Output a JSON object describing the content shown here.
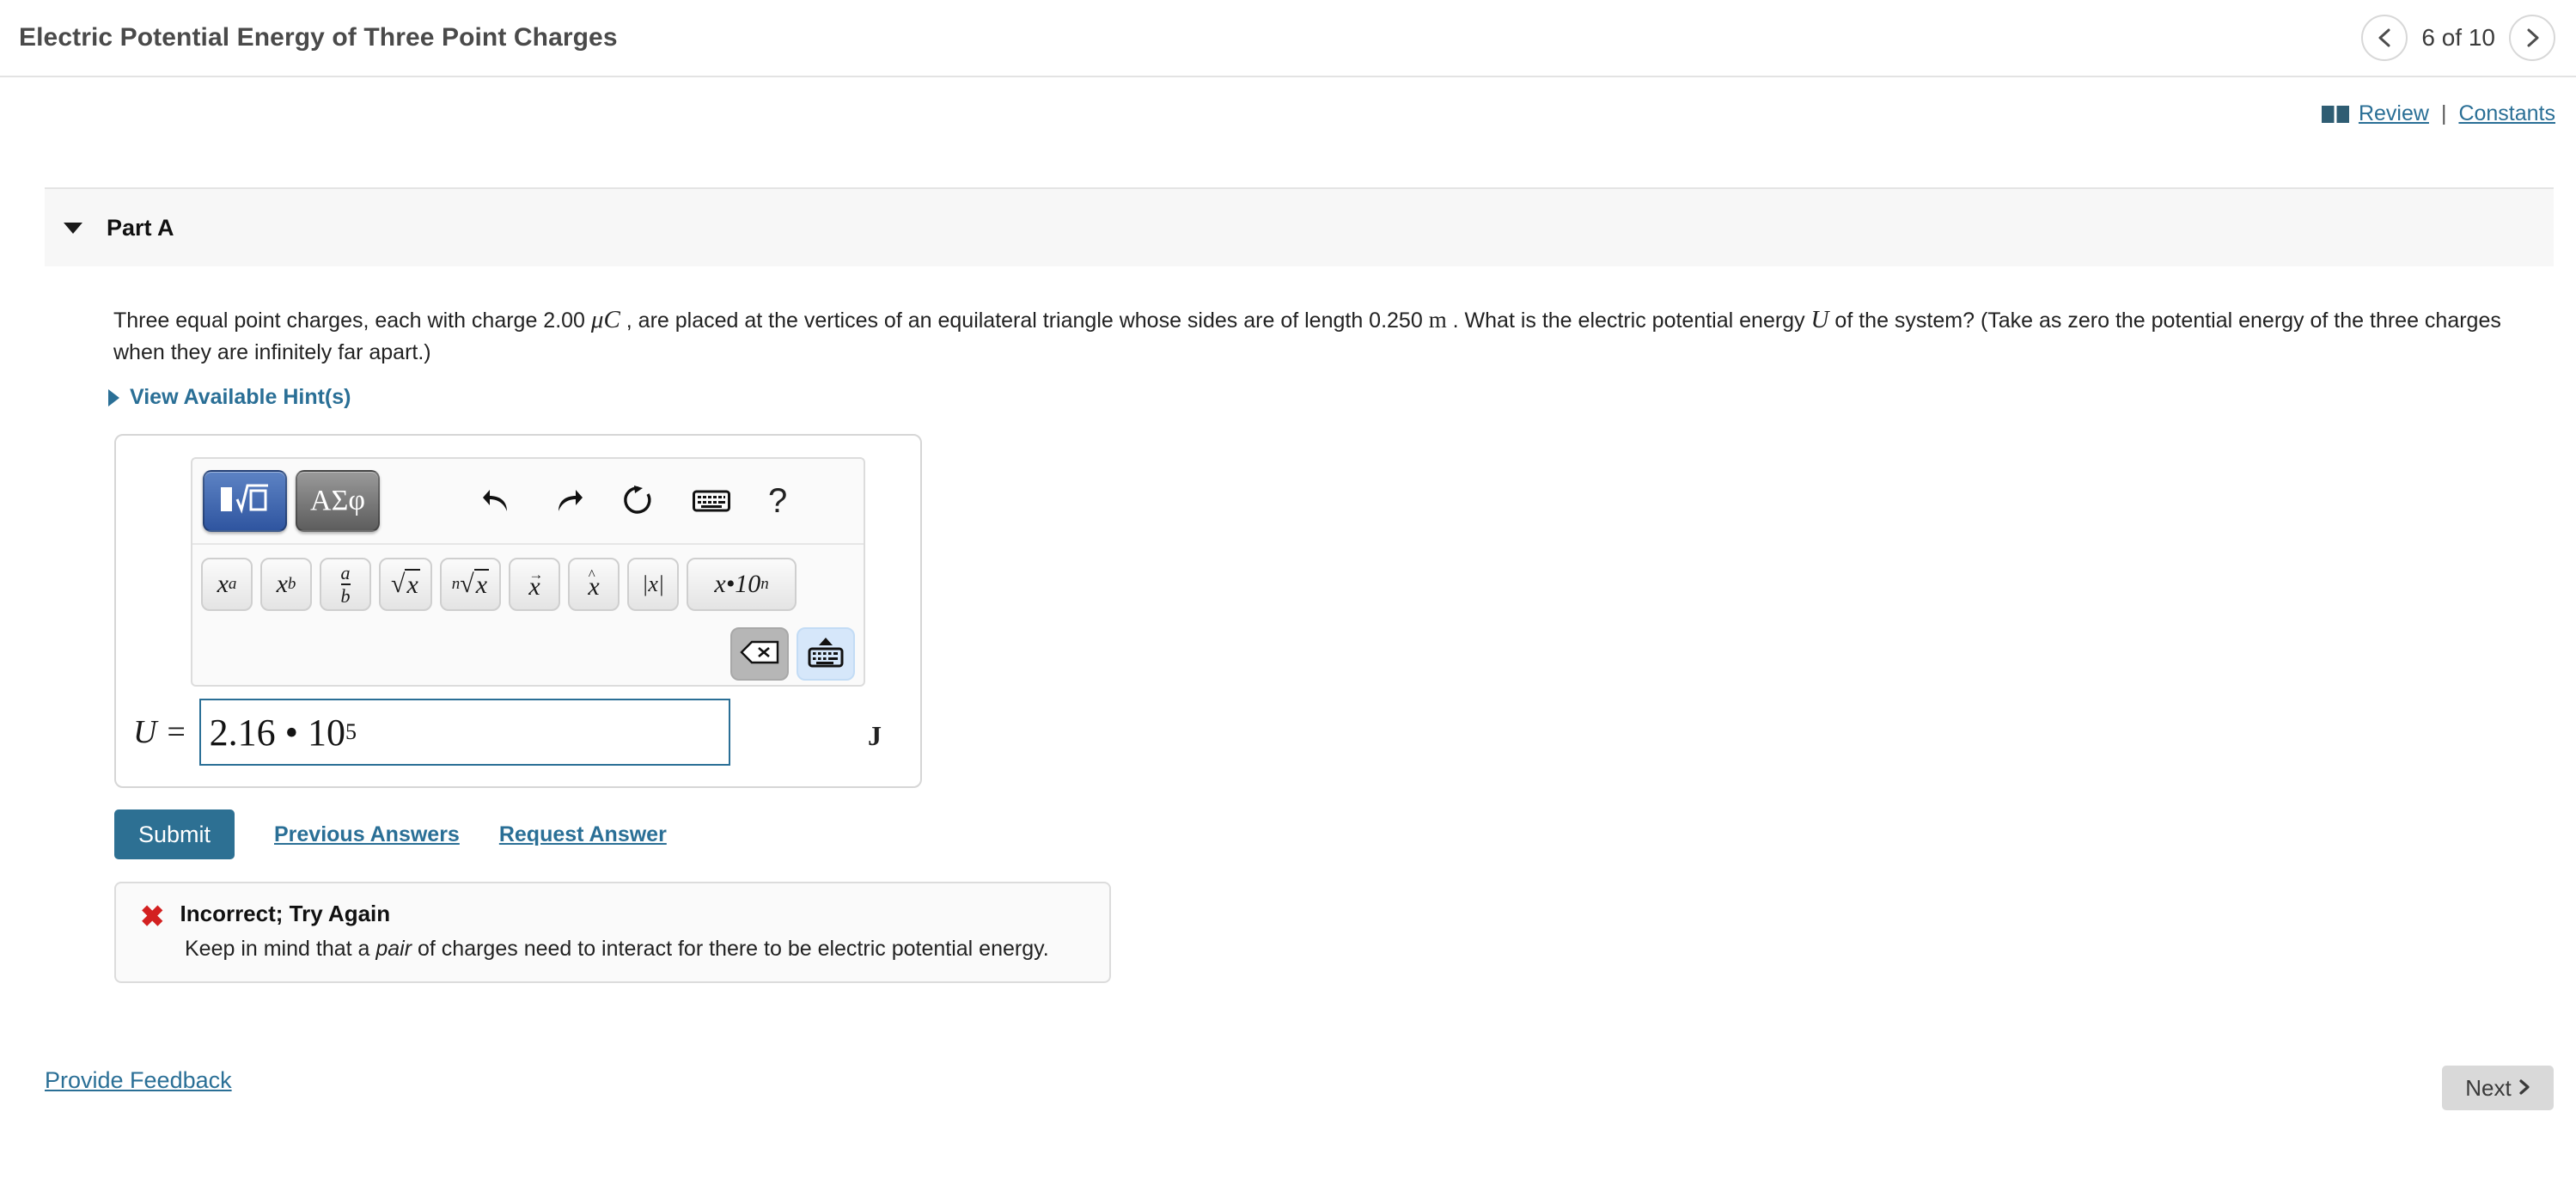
{
  "header": {
    "title": "Electric Potential Energy of Three Point Charges",
    "pager_label": "6 of 10",
    "prev_icon": "chevron-left-icon",
    "next_icon": "chevron-right-icon"
  },
  "toolbar": {
    "book_icon": "book-icon",
    "review_label": "Review",
    "separator": "|",
    "constants_label": "Constants"
  },
  "part": {
    "collapse_icon": "triangle-down-icon",
    "label": "Part A"
  },
  "question": {
    "text_1": "Three equal point charges, each with charge 2.00 ",
    "charge_unit": "μC",
    "text_2": " , are placed at the vertices of an equilateral triangle whose sides are of length 0.250 ",
    "length_unit": "m",
    "text_3": " . What is the electric potential energy ",
    "energy_symbol": "U",
    "text_4": " of the system? (Take as zero the potential energy of the three charges when they are infinitely far apart.)",
    "hints_label": "View Available Hint(s)",
    "hints_icon": "triangle-right-icon"
  },
  "math_palette": {
    "math_mode_button": "math-template-icon",
    "greek_mode_button": "ΑΣφ",
    "undo_icon": "undo-arrow-icon",
    "redo_icon": "redo-arrow-icon",
    "reset_icon": "reset-circular-arrow-icon",
    "keyboard_icon": "keyboard-icon",
    "help_icon": "?",
    "symbols": [
      {
        "name": "superscript-button",
        "label": "xᵃ"
      },
      {
        "name": "subscript-button",
        "label": "x_b"
      },
      {
        "name": "fraction-button",
        "label": "a/b"
      },
      {
        "name": "square-root-button",
        "label": "√x"
      },
      {
        "name": "nth-root-button",
        "label": "ⁿ√x"
      },
      {
        "name": "vector-button",
        "label": "x⃗"
      },
      {
        "name": "unit-vector-button",
        "label": "x̂"
      },
      {
        "name": "absolute-value-button",
        "label": "|x|"
      },
      {
        "name": "scientific-notation-button",
        "label": "x•10ⁿ"
      }
    ],
    "backspace_icon": "backspace-icon",
    "hide_keyboard_icon": "hide-keyboard-icon"
  },
  "answer": {
    "variable": "U =",
    "value_mantissa": "2.16 • 10",
    "value_exponent": "5",
    "unit": "J"
  },
  "actions": {
    "submit_label": "Submit",
    "previous_answers_label": "Previous Answers",
    "request_answer_label": "Request Answer"
  },
  "feedback": {
    "status_icon": "red-x-icon",
    "title": "Incorrect; Try Again",
    "body_1": "Keep in mind that a ",
    "body_emphasis": "pair",
    "body_2": " of charges need to interact for there to be electric potential energy."
  },
  "footer": {
    "feedback_link": "Provide Feedback",
    "next_label": "Next",
    "next_icon": "chevron-right-icon"
  },
  "colors": {
    "link": "#2a6f96",
    "submit": "#2d7093",
    "error": "#d32020",
    "panel_bg": "#f7f7f7"
  }
}
